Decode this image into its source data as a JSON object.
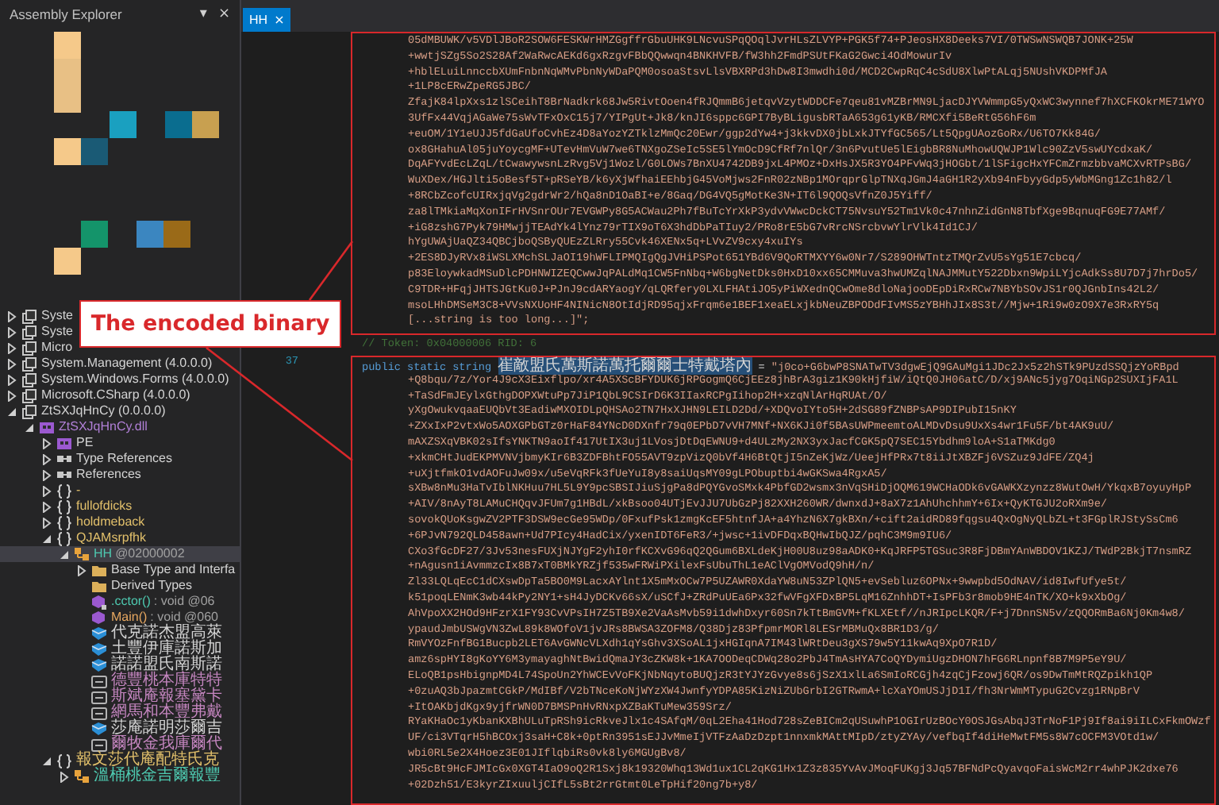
{
  "explorer": {
    "title": "Assembly Explorer",
    "pin": "▾",
    "close": "×",
    "tree": [
      {
        "label": "Syste",
        "kind": "assembly",
        "expanded": false,
        "selected": false
      },
      {
        "label": "Syste",
        "kind": "assembly",
        "expanded": false,
        "selected": false
      },
      {
        "label": "Micro",
        "kind": "assembly",
        "expanded": false,
        "selected": false
      },
      {
        "label": "System.Management (4.0.0.0)",
        "kind": "assembly",
        "expanded": false,
        "selected": false
      },
      {
        "label": "System.Windows.Forms (4.0.0.0)",
        "kind": "assembly",
        "expanded": false,
        "selected": false
      },
      {
        "label": "Microsoft.CSharp (4.0.0.0)",
        "kind": "assembly",
        "expanded": false,
        "selected": false
      },
      {
        "label": "ZtSXJqHnCy (0.0.0.0)",
        "kind": "assembly",
        "expanded": true,
        "selected": false,
        "children": [
          {
            "label": "ZtSXJqHnCy.dll",
            "kind": "module",
            "expanded": true,
            "selected": false,
            "children": [
              {
                "label": "PE",
                "kind": "pe",
                "expanded": false,
                "selected": false
              },
              {
                "label": "Type References",
                "kind": "refs",
                "expanded": false,
                "selected": false
              },
              {
                "label": "References",
                "kind": "refs",
                "expanded": false,
                "selected": false
              },
              {
                "label": "-",
                "kind": "namespace",
                "expanded": false,
                "selected": false
              },
              {
                "label": "fullofdicks",
                "kind": "namespace",
                "expanded": false,
                "selected": false
              },
              {
                "label": "holdmeback",
                "kind": "namespace",
                "expanded": false,
                "selected": false
              },
              {
                "label": "QJAMsrpfhk",
                "kind": "namespace",
                "expanded": true,
                "selected": false,
                "children": [
                  {
                    "label": "HH",
                    "token": "@02000002",
                    "kind": "class",
                    "expanded": true,
                    "selected": true,
                    "children": [
                      {
                        "label": "Base Type and Interfa",
                        "kind": "folder",
                        "expanded": false,
                        "selected": false
                      },
                      {
                        "label": "Derived Types",
                        "kind": "folder",
                        "selected": false
                      },
                      {
                        "label": ".cctor()",
                        "token": ": void @06",
                        "kind": "ctor",
                        "selected": false
                      },
                      {
                        "label": "Main()",
                        "token": ": void @060",
                        "kind": "method",
                        "selected": false
                      },
                      {
                        "label": "代克諾杰盟高萊",
                        "kind": "field",
                        "selected": false
                      },
                      {
                        "label": "土豐伊庫諾斯加",
                        "kind": "field",
                        "selected": false
                      },
                      {
                        "label": "諾諾盟氏南斯諾",
                        "kind": "field",
                        "selected": false
                      },
                      {
                        "label": "德豐桃本庫特特",
                        "kind": "property",
                        "selected": false
                      },
                      {
                        "label": "斯斌庵報塞黛卡",
                        "kind": "property",
                        "selected": false
                      },
                      {
                        "label": "網馬和本豐弗戴",
                        "kind": "property",
                        "selected": false
                      },
                      {
                        "label": "莎庵諾明莎爾吉",
                        "kind": "field",
                        "selected": false
                      },
                      {
                        "label": "爾牧金我庫爾代",
                        "kind": "property",
                        "selected": false
                      }
                    ]
                  }
                ]
              },
              {
                "label": "報文莎代庵配特氏克",
                "kind": "namespace",
                "expanded": true,
                "selected": false,
                "children": [
                  {
                    "label": "溫桶桃金吉爾報豐",
                    "kind": "class",
                    "expanded": false,
                    "selected": false
                  }
                ]
              }
            ]
          }
        ]
      }
    ]
  },
  "editor": {
    "tab": {
      "label": "HH",
      "close": "×",
      "selected": true
    },
    "top_lines": [
      "05dMBUWK/v5VDlJBoR2SOW6FESKWrHMZGgffrGbuUHK9LNcvuSPqQOqlJvrHLsZLVYP+PGK5f74+PJeosHX8Deeks7VI/0TWSwNSWQB7JONK+25W",
      "+wwtjSZg5So2S28Af2WaRwcAEKd6gxRzgvFBbQQwwqn4BNKHVFB/fW3hh2FmdPSUtFKaG2Gwci4OdMowurIv",
      "+hblELuiLnnccbXUmFnbnNqWMvPbnNyWDaPQM0osoaStsvLlsVBXRPd3hDw8I3mwdhi0d/MCD2CwpRqC4cSdU8XlwPtALqj5NUshVKDPMfJA",
      "+1LP8cERwZpeRG5JBC/",
      "ZfajK84lpXxs1zlSCeihT8BrNadkrk68Jw5RivtOoen4fRJQmmB6jetqvVzytWDDCFe7qeu81vMZBrMN9LjacDJYVWmmpG5yQxWC3wynnef7hXCFKOkrME71WYO",
      "3UfFx44VqjAGaWe75sWvTFxOxC15j7/YIPgUt+Jk8/knJI6sppc6GPI7ByBLigusbRTaA653g61yKB/RMCXfi5BeRtG56hF6m",
      "+euOM/1Y1eUJJ5fdGaUfoCvhEz4D8aYozYZTklzMmQc20Ewr/ggp2dYw4+j3kkvDX0jbLxkJTYfGC565/Lt5QpgUAozGoRx/U6TO7Kk84G/",
      "ox8GHahuAl05juYoycgMF+UTevHmVuW7we6TNXgoZSeIc5SE5lYmOcD9CfRf7nlQr/3n6PvutUe5lEigbBR8NuMhowUQWJP1Wlc90ZzV5swUYcdxaK/",
      "DqAFYvdEcLZqL/tCwawywsnLzRvg5Vj1Wozl/G0LOWs7BnXU4742DB9jxL4PMOz+DxHsJX5R3YO4PFvWq3jHOGbt/1lSFigcHxYFCmZrmzbbvaMCXvRTPsBG/",
      "WuXDex/HGJlti5oBesf5T+pRSeYB/k6yXjWfhaiEEhbjG45VoMjws2FnR02zNBp1MOrqprGlpTNXqJGmJ4aGH1R2yXb94nFbyyGdp5yWbMGng1Zc1h82/l",
      "+8RCbZcofcUIRxjqVg2gdrWr2/hQa8nD1OaBI+e/8Gaq/DG4VQ5gMotKe3N+IT6l9QOQsVfnZ0J5Yiff/",
      "za8lTMkiaMqXonIFrHVSnrOUr7EVGWPy8G5ACWau2Ph7fBuTcYrXkP3ydvVWwcDckCT75NvsuY52Tm1Vk0c47nhnZidGnN8TbfXge9BqnuqFG9E77AMf/",
      "+iG8zshG7Pyk79HMwjjTEAdYk4lYnz79rTIX9oT6X3hdDbPaTIuy2/PRo8rE5bG7vRrcNSrcbvwYlrVlk4Id1CJ/",
      "hYgUWAjUaQZ34QBCjboQSByQUEzZLRry55Cvk46XENx5q+LVvZV9cxy4xuIYs",
      "+2ES8DJyRVx8iWSLXMchSLJaOI19hWFLIPMQIgQgJVHiPSPot651YBd6V9QoRTMXYY6w0Nr7/S289OHWTntzTMQrZvU5sYg51E7cbcq/",
      "p83EloywkadMSuDlcPDHNWIZEQCwwJqPALdMq1CW5FnNbq+W6bgNetDks0HxD10xx65CMMuva3hwUMZqlNAJMMutY522Dbxn9WpiLYjcAdkSs8U7D7j7hrDo5/",
      "C9TDR+HFqjJHTSJGtKu0J+PJnJ9cdARYaogY/qLQRfery0LXLFHAtiJO5yPiWXednQCwOme8dloNajooDEpDiRxRCw7NBYbSOvJS1r0QJGnbIns42L2/",
      "msoLHhDMSeM3C8+VVsNXUoHF4NINicN8OtIdjRD95qjxFrqm6e1BEF1xeaELxjkbNeuZBPODdFIvMS5zYBHhJIx8S3t//Mjw+1Ri9w0zO9X7e3RxRY5q",
      "[...string is too long...]\";"
    ],
    "token_comment": "// Token: 0x04000006 RID: 6",
    "declaration": {
      "line_number": "37",
      "keyword": "public static string",
      "name": "崔敵盟氏萬斯諾萬托爾爾士特戴塔內",
      "operator": "=",
      "value": "\"j0co+G6bwP8SNATwTV3dgwEjQ9GAuMgi1JDc2Jx5z2hSTk9PUzdSSQjzYoRBpd"
    },
    "continuation": [
      "+Q8bqu/7z/Yor4J9cX3Eixflpo/xr4A5XScBFYDUK6jRPGogmQ6CjEEz8jhBrA3giz1K90kHjfiW/iQtQ0JH06atC/D/xj9ANc5jyg7OqiNGp2SUXIjFA1L",
      "+TaSdFmJEylxGthgDOPXWtuPp7JiP1QbL9CSIrD6K3IIaxRCPgIihop2H+xzqNlArHqRUAt/O/",
      "yXgOwukvqaaEUQbVt3EadiwMXOIDLpQHSAo2TN7HxXJHN9LEILD2Dd/+XDQvoIYto5H+2dSG89fZNBPsAP9DIPubI15nKY",
      "+ZXxIxP2vtxWo5AOXGPbGTz0rHaF84YNcD0DXnfr79q0EPbD7vVH7MNf+NX6KJi0f5BAsUWPmeemtoALMDvDsu9UxXs4wr1Fu5F/bt4AK9uU/",
      "mAXZSXqVBK02sIfsYNKTN9aoIf417UtIX3uj1LVosjDtDqEWNU9+d4ULzMy2NX3yxJacfCGK5pQ7SEC15Ybdhm9loA+S1aTMKdg0",
      "+xkmCHtJudEKPMVNVjbmyKIr6B3ZDFBhtFO55AVT9zpVizQ0bVf4H6BtQtjI5nZeKjWz/UeejHfPRx7t8iiJtXBZFj6VSZuz9JdFE/ZQ4j",
      "+uXjtfmkO1vdAOFuJw09x/u5eVqRFk3fUeYuI8y8saiUqsMY09gLPObuptbi4wGKSwa4RgxA5/",
      "sXBw8nMu3HaTvIblNKHuu7HL5L9Y9pcSBSIJiuSjgPa8dPQYGvoSMxk4PbfGD2wsmx3nVqSHiDjOQM619WCHaODk6vGAWKXzynzz8WutOwH/YkqxB7oyuyHpP",
      "+AIV/8nAyT8LAMuCHQqvJFUm7g1HBdL/xkBsoo04UTjEvJJU7UbGzPj82XXH260WR/dwnxdJ+8aX7z1AhUhchhmY+6Ix+QyKTGJU2oRXm9e/",
      "sovokQUoKsgwZV2PTF3DSW9ecGe95WDp/0FxufPsk1zmgKcEF5htnfJA+a4YhzN6X7gkBXn/+cift2aidRD89fqgsu4QxOgNyQLbZL+t3FGplRJStySsCm6",
      "+6PJvN792QLD458awn+Ud7PIcy4HadCix/yxenIDT6FeR3/+jwsc+1ivDFDqxBQHwIbQJZ/pqhC3M9m9IU6/",
      "CXo3fGcDF27/3Jv53nesFUXjNJYgF2yhI0rfKCXvG96qQ2QGum6BXLdeKjH00U8uz98aADK0+KqJRFP5TGSuc3R8FjDBmYAnWBDOV1KZJ/TWdP2BkjT7nsmRZ",
      "+nAgusn1iAvmmzcIx8B7xT0BMkYRZjf535wFRWiPXilexFsUbuThL1eAClVgOMVodQ9hH/n/",
      "Zl33LQLqEcC1dCXswDpTa5BO0M9LacxAYlnt1X5mMxOCw7P5UZAWR0XdaYW8uN53ZPlQN5+evSebluz6OPNx+9wwpbd5OdNAV/id8IwfUfye5t/",
      "k51poqLENmK3wb44kPy2NY1+sH4JyDCKv66sX/uSCfJ+ZRdPuUEa6Px32fwVFgXFDxBP5LqM16ZnhhDT+IsPFb3r8mob9HE4nTK/XO+k9xXbOg/",
      "AhVpoXX2HOd9HFzrX1FY93CvVPsIH7Z5TB9Xe2VaAsMvb59i1dwhDxyr60Sn7kTtBmGVM+fKLXEtf//nJRIpcLKQR/F+j7DnnSN5v/zQQORmBa6Nj0Km4w8/",
      "ypaudJmbUSWgVN3ZwL89k8WOfoV1jvJRs8BWSA3ZOFM8/Q38Djz83PfpmrMORl8LESrMBMuQx8BR1D3/g/",
      "RmVYOzFnfBG1Bucpb2LET6AvGWNcVLXdh1qYsGhv3XSoAL1jxHGIqnA7IM43lWRtDeu3gXS79w5Y11kwAq9XpO7R1D/",
      "amz6spHYI8gKoYY6M3ymayaghNtBwidQmaJY3cZKW8k+1KA7OODeqCDWq28o2PbJ4TmAsHYA7CoQYDymiUgzDHON7hFG6RLnpnf8B7M9P5eY9U/",
      "ELoQB1psHbignpMD4L74SpoUn2YhWCEvVoFKjNbNqytoBUQjzR3tYJYzGvye8s6jSzX1xlLa6SmIoRCGjh4zqCjFzowj6QR/os9DwTmMtRQZpikh1QP",
      "+0zuAQ3bJpazmtCGkP/MdIBf/V2bTNceKoNjWYzXW4JwnfyYDPA85KizNiZUbGrbI2GTRwmA+lcXaYOmUSJjD1I/fh3NrWmMTypuG2Cvzg1RNpBrV",
      "+ItOAKbjdKgx9yjfrWN0D7BMSPnHvRNxpXZBaKTuMew359Srz/",
      "RYaKHaOc1yKbanKXBhULuTpRSh9icRkveJlx1c4SAfqM/0qL2Eha41Hod728sZeBICm2qUSuwhP1OGIrUzBOcY0OSJGsAbqJ3TrNoF1Pj9If8ai9iILCxFkmOWzf",
      "UF/ci3VTqrH5hBCOxj3saH+C8k+0ptRn3951sEJJvMmeIjVTFzAaDzDzpt1nnxmkMAttMIpD/ztyZYAy/vefbqIf4diHeMwtFM5s8W7cOCFM3VOtd1w/",
      "wbi0RL5e2X4Hoez3E01JIflqbiRs0vk8ly6MGUgBv8/",
      "JR5cBt9HcFJMIcGx0XGT4IaO9oQ2R1Sxj8k19320Whq13Wd1ux1CL2qKG1Hx1Z3z835YvAvJMoqFUKgj3Jq57BFNdPcQyavqoFaisWcM2rr4whPJK2dxe76",
      "+02Dzh51/E3kyrZIxuuljCIfL5sBt2rrGtmt0LeTpHif20ng7b+y8/"
    ]
  },
  "annotation": {
    "text": "The encoded binary"
  }
}
